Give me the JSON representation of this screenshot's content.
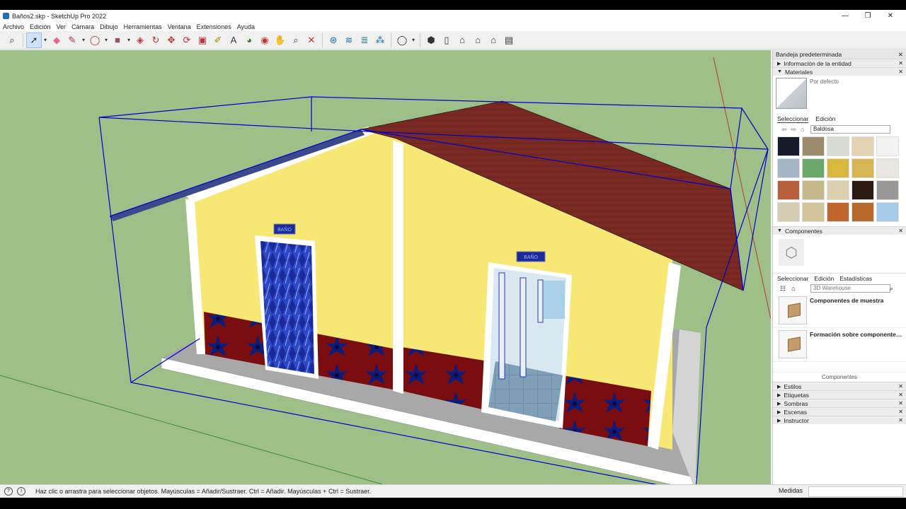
{
  "window": {
    "title": "Baños2.skp - SketchUp Pro 2022",
    "controls": [
      "—",
      "❐",
      "✕"
    ]
  },
  "menu": [
    "Archivo",
    "Edición",
    "Ver",
    "Cámara",
    "Dibujo",
    "Herramientas",
    "Ventana",
    "Extensiones",
    "Ayuda"
  ],
  "toolbar": {
    "tools": [
      "search-icon",
      "select-icon",
      "eraser-icon",
      "pencil-icon",
      "shape-icon",
      "paint-icon",
      "pushpull-icon",
      "move-icon",
      "rotate-icon",
      "scale-icon",
      "offset-icon",
      "tape-icon",
      "text-icon",
      "paint-bucket-icon",
      "orbit-icon",
      "pan-icon",
      "zoom-icon",
      "zoom-extents-icon",
      "warehouse-icon",
      "extension-icon",
      "account-icon",
      "iso-view-icon",
      "top-view-icon",
      "front-view-icon",
      "right-view-icon",
      "back-view-icon",
      "left-view-icon"
    ]
  },
  "scene": {
    "signs": [
      "BAÑO",
      "BAÑO"
    ],
    "colors": {
      "sky": "#9fbf89",
      "wall": "#f7e774",
      "roof": "#7a2a22",
      "wainscot": "#7a0d10",
      "base": "#a9a9a9",
      "outline": "#0000cc"
    }
  },
  "tray": {
    "title": "Bandeja predeterminada",
    "panels": {
      "entity_info": "Información de la entidad",
      "materials": {
        "title": "Materiales",
        "current": "Por defecto",
        "tabs": [
          "Seleccionar",
          "Edición"
        ],
        "library": "Baldosa",
        "swatch_colors": [
          "#151a2c",
          "#9b8a6c",
          "#d9dcd5",
          "#e3d2b4",
          "#f2f2f2",
          "#a5b6c4",
          "#6ba86e",
          "#d9b83d",
          "#d7b454",
          "#e8e6e1",
          "#b85f3b",
          "#c5b98c",
          "#ddd0b1",
          "#2a1a12",
          "#9a9797",
          "#d6cbb3",
          "#d2c59a",
          "#c0652c",
          "#b5682a",
          "#a7c9e8"
        ]
      },
      "components": {
        "title": "Componentes",
        "tabs": [
          "Seleccionar",
          "Edición",
          "Estadísticas"
        ],
        "search_placeholder": "3D Warehouse",
        "items": [
          "Componentes de muestra",
          "Formación sobre componentes di..."
        ],
        "footer": "Componentes"
      },
      "collapsed": [
        "Estilos",
        "Etiquetas",
        "Sombras",
        "Escenas",
        "Instructor"
      ]
    }
  },
  "status": {
    "message": "Haz clic o arrastra para seleccionar objetos. Mayúsculas = Añadir/Sustraer. Ctrl = Añadir. Mayúsculas + Ctrl = Sustraer.",
    "measure_label": "Medidas"
  }
}
